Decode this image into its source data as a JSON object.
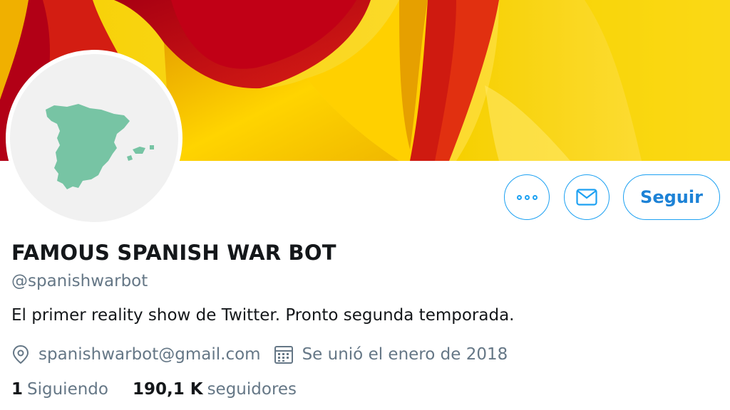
{
  "profile": {
    "name": "FAMOUS SPANISH WAR BOT",
    "handle": "@spanishwarbot",
    "bio": "El primer reality show de Twitter. Pronto segunda temporada.",
    "email": "spanishwarbot@gmail.com",
    "joined": "Se unió el enero de 2018"
  },
  "actions": {
    "more_icon": "more-dots-icon",
    "message_icon": "envelope-icon",
    "follow_label": "Seguir"
  },
  "stats": {
    "following_count": "1",
    "following_label": "Siguiendo",
    "followers_count": "190,1 K",
    "followers_label": "seguidores"
  },
  "colors": {
    "accent": "#1da1f2",
    "follow_text": "#1d82d6",
    "secondary_text": "#657786",
    "map_green": "#77c4a4",
    "flag_red": "#c8102e",
    "flag_yellow": "#f2c200"
  }
}
